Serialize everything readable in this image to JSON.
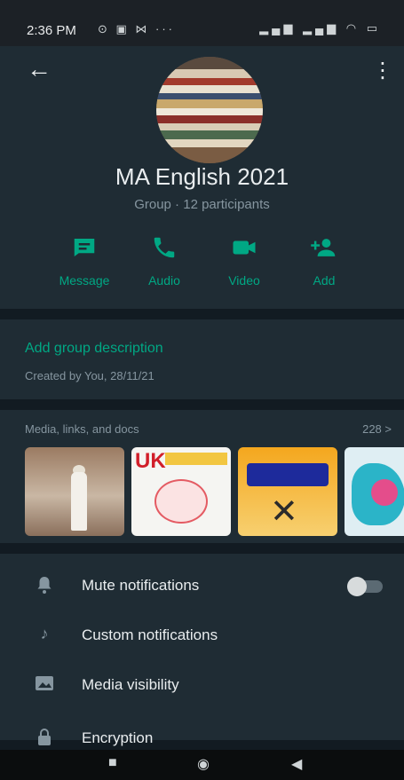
{
  "status_bar": {
    "time": "2:36 PM",
    "left_icons": "⊙ ▣ ⋈ ···",
    "right_icons": "▂▄▆ ▂▄▆ ◠ ▭"
  },
  "header": {
    "title": "MA English 2021",
    "subtitle": "Group · 12 participants",
    "back_icon": "arrow-back-icon",
    "menu_icon": "more-vert-icon"
  },
  "actions": [
    {
      "label": "Message",
      "icon": "message-icon"
    },
    {
      "label": "Audio",
      "icon": "phone-icon"
    },
    {
      "label": "Video",
      "icon": "video-icon"
    },
    {
      "label": "Add",
      "icon": "add-person-icon"
    }
  ],
  "description": {
    "link": "Add group description",
    "created": "Created by You, 28/11/21"
  },
  "media": {
    "title": "Media, links, and docs",
    "count": "228 >",
    "thumb_texts": {
      "uk": "UK"
    }
  },
  "settings": [
    {
      "label": "Mute notifications",
      "icon": "bell-icon",
      "toggle": false
    },
    {
      "label": "Custom notifications",
      "icon": "music-note-icon"
    },
    {
      "label": "Media visibility",
      "icon": "image-icon"
    },
    {
      "label": "Encryption",
      "icon": "lock-icon"
    }
  ],
  "colors": {
    "accent": "#00a884",
    "panel": "#1f2c34",
    "background": "#121b22"
  }
}
